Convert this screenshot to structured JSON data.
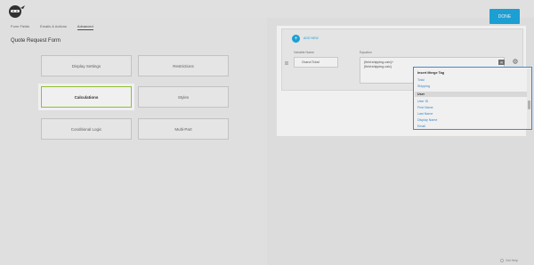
{
  "header": {
    "done_label": "DONE"
  },
  "tabs": [
    {
      "label": "Form Fields"
    },
    {
      "label": "Emails & Actions"
    },
    {
      "label": "Advanced"
    }
  ],
  "form_title": "Quote Request Form",
  "settings_cards": [
    {
      "label": "Display Settings"
    },
    {
      "label": "Restrictions"
    },
    {
      "label": "Calculations"
    },
    {
      "label": "Styles"
    },
    {
      "label": "Conditional Logic"
    },
    {
      "label": "Multi-Part"
    }
  ],
  "calc_panel": {
    "add_label": "ADD NEW",
    "variable_header": "Variable Name",
    "equation_header": "Equation",
    "variable_value": "Grand Total",
    "equation_line1": "{field:shipping-calc}+",
    "equation_line2": "{field:shipping-calc}"
  },
  "merge_dropdown": {
    "title": "Insert Merge Tag",
    "items_top": [
      "Total",
      "Shipping"
    ],
    "group_label": "User",
    "items_user": [
      "User ID",
      "First Name",
      "Last Name",
      "Display Name",
      "Email"
    ]
  },
  "help": {
    "label": "Get Help"
  },
  "colors": {
    "accent": "#1ea9e1",
    "selected_border": "#9acd32",
    "dropdown_border": "#4a90d9"
  }
}
